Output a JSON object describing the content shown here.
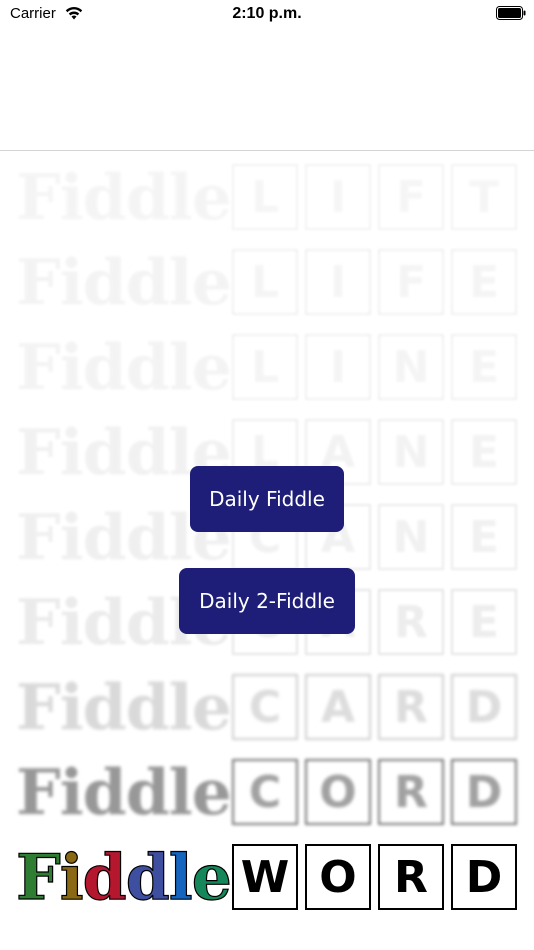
{
  "status_bar": {
    "carrier": "Carrier",
    "time": "2:10 p.m."
  },
  "background_rows": [
    {
      "label": "Fiddle",
      "letters": [
        "L",
        "I",
        "F",
        "T"
      ],
      "opacity": 0.05
    },
    {
      "label": "Fiddle",
      "letters": [
        "L",
        "I",
        "F",
        "E"
      ],
      "opacity": 0.06
    },
    {
      "label": "Fiddle",
      "letters": [
        "L",
        "I",
        "N",
        "E"
      ],
      "opacity": 0.06
    },
    {
      "label": "Fiddle",
      "letters": [
        "L",
        "A",
        "N",
        "E"
      ],
      "opacity": 0.07
    },
    {
      "label": "Fiddle",
      "letters": [
        "C",
        "A",
        "N",
        "E"
      ],
      "opacity": 0.08
    },
    {
      "label": "Fiddle",
      "letters": [
        "C",
        "A",
        "R",
        "E"
      ],
      "opacity": 0.1
    },
    {
      "label": "Fiddle",
      "letters": [
        "C",
        "A",
        "R",
        "D"
      ],
      "opacity": 0.2
    },
    {
      "label": "Fiddle",
      "letters": [
        "C",
        "O",
        "R",
        "D"
      ],
      "opacity": 0.55
    },
    {
      "label": "Fiddle",
      "letters": [
        "W",
        "O",
        "R",
        "D"
      ],
      "opacity": 1.0
    }
  ],
  "logo_colors": [
    "#2e7d32",
    "#8b6914",
    "#b5172e",
    "#3f4fa0",
    "#1565c0",
    "#16875a"
  ],
  "buttons": {
    "daily_fiddle": "Daily Fiddle",
    "daily_2_fiddle": "Daily 2-Fiddle"
  },
  "colors": {
    "button_bg": "#1e1e78",
    "button_text": "#ffffff"
  }
}
